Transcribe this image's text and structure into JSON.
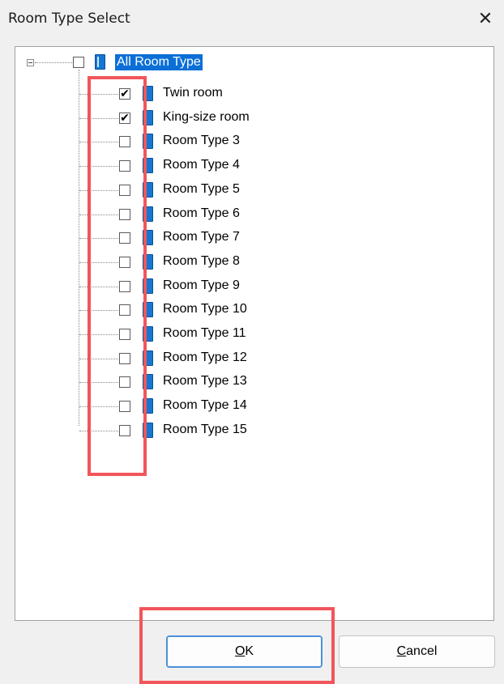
{
  "window": {
    "title": "Room Type Select",
    "close_glyph": "✕"
  },
  "tree": {
    "root": {
      "label": "All Room Type",
      "checked": false,
      "expanded": true
    },
    "items": [
      {
        "label": "Twin room",
        "checked": true
      },
      {
        "label": "King-size room",
        "checked": true
      },
      {
        "label": "Room Type 3",
        "checked": false
      },
      {
        "label": "Room Type 4",
        "checked": false
      },
      {
        "label": "Room Type 5",
        "checked": false
      },
      {
        "label": "Room Type 6",
        "checked": false
      },
      {
        "label": "Room Type 7",
        "checked": false
      },
      {
        "label": "Room Type 8",
        "checked": false
      },
      {
        "label": "Room Type 9",
        "checked": false
      },
      {
        "label": "Room Type 10",
        "checked": false
      },
      {
        "label": "Room Type 11",
        "checked": false
      },
      {
        "label": "Room Type 12",
        "checked": false
      },
      {
        "label": "Room Type 13",
        "checked": false
      },
      {
        "label": "Room Type 14",
        "checked": false
      },
      {
        "label": "Room Type 15",
        "checked": false
      }
    ]
  },
  "buttons": {
    "ok": {
      "accel": "O",
      "rest": "K"
    },
    "cancel": {
      "accel": "C",
      "rest": "ancel"
    }
  },
  "colors": {
    "selection": "#0b6fd6",
    "highlight": "#f2555a",
    "item_icon": "#1478d2"
  }
}
